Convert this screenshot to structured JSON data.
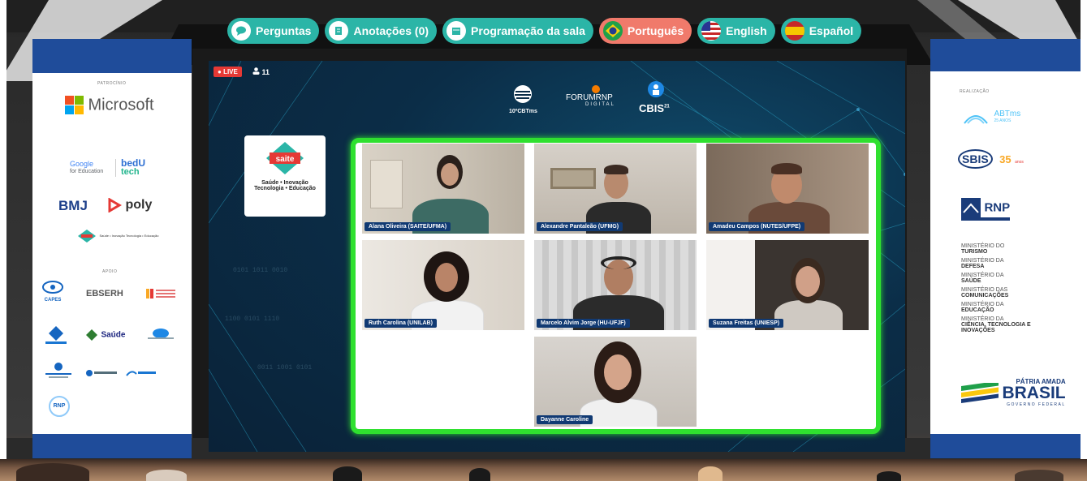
{
  "topbar": {
    "buttons": [
      {
        "label": "Perguntas",
        "icon": "chat-icon",
        "color": "#2bb5a7"
      },
      {
        "label": "Anotações (0)",
        "icon": "notes-icon",
        "color": "#2bb5a7"
      },
      {
        "label": "Programação da sala",
        "icon": "schedule-icon",
        "color": "#2bb5a7"
      },
      {
        "label": "Português",
        "icon": "brazil-flag-icon",
        "color": "#f07a6b"
      },
      {
        "label": "English",
        "icon": "usa-flag-icon",
        "color": "#2bb5a7"
      },
      {
        "label": "Español",
        "icon": "spain-flag-icon",
        "color": "#2bb5a7"
      }
    ]
  },
  "left_banner": {
    "patrocinio": "PATROCÍNIO",
    "microsoft": "Microsoft",
    "google": "Google",
    "google_sub": "for Education",
    "bedu": "bedU",
    "bedu_sub": "tech",
    "bmj": "BMJ",
    "poly": "poly",
    "saite_small": "Saúde • Inovação Tecnologia • Educação",
    "apoio": "APOIO",
    "capes": "CAPES",
    "ebserh": "EBSERH",
    "saude": "Saúde",
    "rnp_small": "RNP"
  },
  "screen": {
    "live": "LIVE",
    "viewers": "11",
    "event_logos": [
      "10ºCBTms",
      "FORUMRNP",
      "DIGITAL",
      "CBIS",
      "21"
    ],
    "saite": {
      "name": "saite",
      "tagline1": "Saúde • Inovação",
      "tagline2": "Tecnologia • Educação"
    },
    "participants": [
      {
        "name": "Alana Oliveira (SAITE/UFMA)"
      },
      {
        "name": "Alexandre Pantaleão (UFMG)"
      },
      {
        "name": "Amadeu Campos (NUTES/UFPE)"
      },
      {
        "name": "Ruth Carolina (UNILAB)"
      },
      {
        "name": "Marcelo Alvim Jorge (HU-UFJF)"
      },
      {
        "name": "Suzana Freitas (UNIESP)"
      },
      {
        "name": "Dayanne Caroline"
      }
    ]
  },
  "right_banner": {
    "realizacao": "REALIZAÇÃO",
    "abtms": "ABTms",
    "abtms_sub": "25 ANOS",
    "sbis": "SBIS",
    "sbis_years": "35",
    "sbis_sub": "anos",
    "rnp": "RNP",
    "ministries": [
      {
        "top": "MINISTÉRIO DO",
        "bottom": "TURISMO"
      },
      {
        "top": "MINISTÉRIO DA",
        "bottom": "DEFESA"
      },
      {
        "top": "MINISTÉRIO DA",
        "bottom": "SAÚDE"
      },
      {
        "top": "MINISTÉRIO DAS",
        "bottom": "COMUNICAÇÕES"
      },
      {
        "top": "MINISTÉRIO DA",
        "bottom": "EDUCAÇÃO"
      },
      {
        "top": "MINISTÉRIO DA",
        "bottom": "CIÊNCIA, TECNOLOGIA E INOVAÇÕES"
      }
    ],
    "brasil_top": "PÁTRIA AMADA",
    "brasil": "BRASIL",
    "brasil_sub": "GOVERNO FEDERAL"
  },
  "colors": {
    "teal": "#2bb5a7",
    "coral": "#f07a6b",
    "green_frame": "#2fe02f",
    "navy": "#1f4c9a",
    "caption": "#113a73"
  }
}
